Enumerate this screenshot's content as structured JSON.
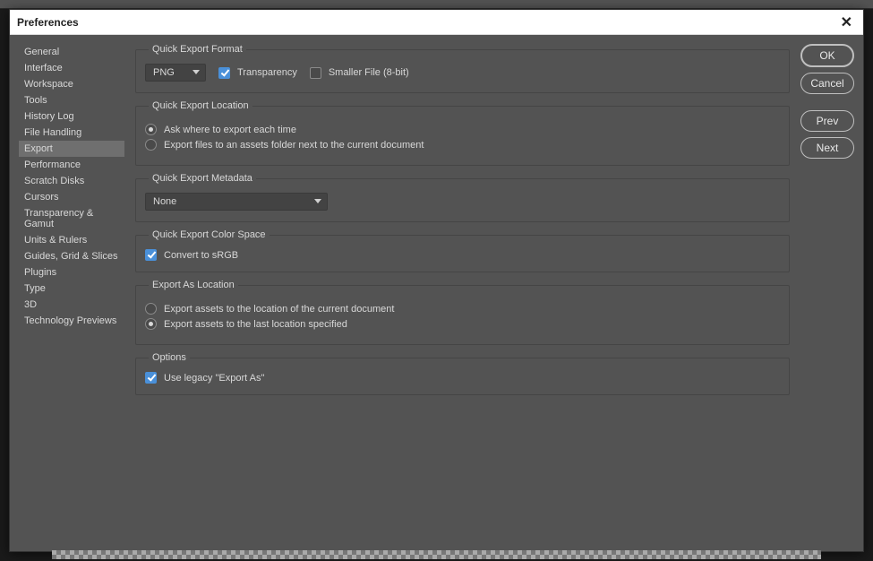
{
  "title": "Preferences",
  "sidebar": {
    "items": [
      {
        "label": "General"
      },
      {
        "label": "Interface"
      },
      {
        "label": "Workspace"
      },
      {
        "label": "Tools"
      },
      {
        "label": "History Log"
      },
      {
        "label": "File Handling"
      },
      {
        "label": "Export"
      },
      {
        "label": "Performance"
      },
      {
        "label": "Scratch Disks"
      },
      {
        "label": "Cursors"
      },
      {
        "label": "Transparency & Gamut"
      },
      {
        "label": "Units & Rulers"
      },
      {
        "label": "Guides, Grid & Slices"
      },
      {
        "label": "Plugins"
      },
      {
        "label": "Type"
      },
      {
        "label": "3D"
      },
      {
        "label": "Technology Previews"
      }
    ],
    "active_index": 6
  },
  "groups": {
    "format": {
      "legend": "Quick Export Format",
      "format_value": "PNG",
      "transparency_label": "Transparency",
      "transparency_checked": true,
      "smaller_label": "Smaller File (8-bit)",
      "smaller_checked": false
    },
    "location": {
      "legend": "Quick Export Location",
      "opt_ask": "Ask where to export each time",
      "opt_assets": "Export files to an assets folder next to the current document",
      "selected": "ask"
    },
    "metadata": {
      "legend": "Quick Export Metadata",
      "value": "None"
    },
    "colorspace": {
      "legend": "Quick Export Color Space",
      "convert_label": "Convert to sRGB",
      "convert_checked": true
    },
    "exportas": {
      "legend": "Export As Location",
      "opt_current": "Export assets to the location of the current document",
      "opt_last": "Export assets to the last location specified",
      "selected": "last"
    },
    "options": {
      "legend": "Options",
      "legacy_label": "Use legacy \"Export As\"",
      "legacy_checked": true
    }
  },
  "buttons": {
    "ok": "OK",
    "cancel": "Cancel",
    "prev": "Prev",
    "next": "Next"
  }
}
